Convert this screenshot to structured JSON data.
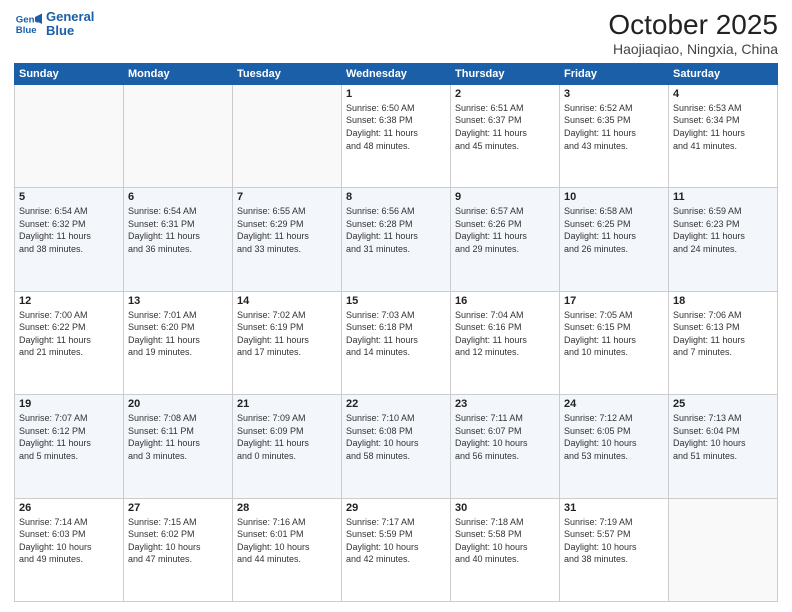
{
  "header": {
    "logo_line1": "General",
    "logo_line2": "Blue",
    "title": "October 2025",
    "subtitle": "Haojiaqiao, Ningxia, China"
  },
  "days_of_week": [
    "Sunday",
    "Monday",
    "Tuesday",
    "Wednesday",
    "Thursday",
    "Friday",
    "Saturday"
  ],
  "weeks": [
    [
      {
        "day": "",
        "info": ""
      },
      {
        "day": "",
        "info": ""
      },
      {
        "day": "",
        "info": ""
      },
      {
        "day": "1",
        "info": "Sunrise: 6:50 AM\nSunset: 6:38 PM\nDaylight: 11 hours\nand 48 minutes."
      },
      {
        "day": "2",
        "info": "Sunrise: 6:51 AM\nSunset: 6:37 PM\nDaylight: 11 hours\nand 45 minutes."
      },
      {
        "day": "3",
        "info": "Sunrise: 6:52 AM\nSunset: 6:35 PM\nDaylight: 11 hours\nand 43 minutes."
      },
      {
        "day": "4",
        "info": "Sunrise: 6:53 AM\nSunset: 6:34 PM\nDaylight: 11 hours\nand 41 minutes."
      }
    ],
    [
      {
        "day": "5",
        "info": "Sunrise: 6:54 AM\nSunset: 6:32 PM\nDaylight: 11 hours\nand 38 minutes."
      },
      {
        "day": "6",
        "info": "Sunrise: 6:54 AM\nSunset: 6:31 PM\nDaylight: 11 hours\nand 36 minutes."
      },
      {
        "day": "7",
        "info": "Sunrise: 6:55 AM\nSunset: 6:29 PM\nDaylight: 11 hours\nand 33 minutes."
      },
      {
        "day": "8",
        "info": "Sunrise: 6:56 AM\nSunset: 6:28 PM\nDaylight: 11 hours\nand 31 minutes."
      },
      {
        "day": "9",
        "info": "Sunrise: 6:57 AM\nSunset: 6:26 PM\nDaylight: 11 hours\nand 29 minutes."
      },
      {
        "day": "10",
        "info": "Sunrise: 6:58 AM\nSunset: 6:25 PM\nDaylight: 11 hours\nand 26 minutes."
      },
      {
        "day": "11",
        "info": "Sunrise: 6:59 AM\nSunset: 6:23 PM\nDaylight: 11 hours\nand 24 minutes."
      }
    ],
    [
      {
        "day": "12",
        "info": "Sunrise: 7:00 AM\nSunset: 6:22 PM\nDaylight: 11 hours\nand 21 minutes."
      },
      {
        "day": "13",
        "info": "Sunrise: 7:01 AM\nSunset: 6:20 PM\nDaylight: 11 hours\nand 19 minutes."
      },
      {
        "day": "14",
        "info": "Sunrise: 7:02 AM\nSunset: 6:19 PM\nDaylight: 11 hours\nand 17 minutes."
      },
      {
        "day": "15",
        "info": "Sunrise: 7:03 AM\nSunset: 6:18 PM\nDaylight: 11 hours\nand 14 minutes."
      },
      {
        "day": "16",
        "info": "Sunrise: 7:04 AM\nSunset: 6:16 PM\nDaylight: 11 hours\nand 12 minutes."
      },
      {
        "day": "17",
        "info": "Sunrise: 7:05 AM\nSunset: 6:15 PM\nDaylight: 11 hours\nand 10 minutes."
      },
      {
        "day": "18",
        "info": "Sunrise: 7:06 AM\nSunset: 6:13 PM\nDaylight: 11 hours\nand 7 minutes."
      }
    ],
    [
      {
        "day": "19",
        "info": "Sunrise: 7:07 AM\nSunset: 6:12 PM\nDaylight: 11 hours\nand 5 minutes."
      },
      {
        "day": "20",
        "info": "Sunrise: 7:08 AM\nSunset: 6:11 PM\nDaylight: 11 hours\nand 3 minutes."
      },
      {
        "day": "21",
        "info": "Sunrise: 7:09 AM\nSunset: 6:09 PM\nDaylight: 11 hours\nand 0 minutes."
      },
      {
        "day": "22",
        "info": "Sunrise: 7:10 AM\nSunset: 6:08 PM\nDaylight: 10 hours\nand 58 minutes."
      },
      {
        "day": "23",
        "info": "Sunrise: 7:11 AM\nSunset: 6:07 PM\nDaylight: 10 hours\nand 56 minutes."
      },
      {
        "day": "24",
        "info": "Sunrise: 7:12 AM\nSunset: 6:05 PM\nDaylight: 10 hours\nand 53 minutes."
      },
      {
        "day": "25",
        "info": "Sunrise: 7:13 AM\nSunset: 6:04 PM\nDaylight: 10 hours\nand 51 minutes."
      }
    ],
    [
      {
        "day": "26",
        "info": "Sunrise: 7:14 AM\nSunset: 6:03 PM\nDaylight: 10 hours\nand 49 minutes."
      },
      {
        "day": "27",
        "info": "Sunrise: 7:15 AM\nSunset: 6:02 PM\nDaylight: 10 hours\nand 47 minutes."
      },
      {
        "day": "28",
        "info": "Sunrise: 7:16 AM\nSunset: 6:01 PM\nDaylight: 10 hours\nand 44 minutes."
      },
      {
        "day": "29",
        "info": "Sunrise: 7:17 AM\nSunset: 5:59 PM\nDaylight: 10 hours\nand 42 minutes."
      },
      {
        "day": "30",
        "info": "Sunrise: 7:18 AM\nSunset: 5:58 PM\nDaylight: 10 hours\nand 40 minutes."
      },
      {
        "day": "31",
        "info": "Sunrise: 7:19 AM\nSunset: 5:57 PM\nDaylight: 10 hours\nand 38 minutes."
      },
      {
        "day": "",
        "info": ""
      }
    ]
  ]
}
